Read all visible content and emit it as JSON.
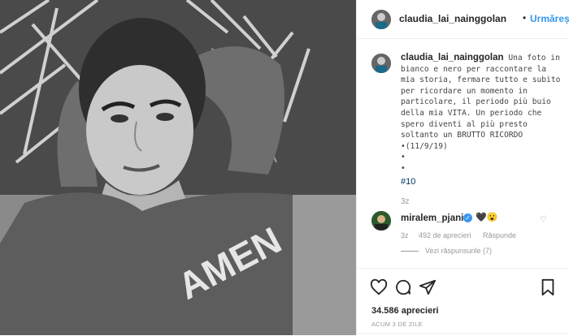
{
  "photo": {
    "alt_shirt_text": "AMEN",
    "colors": {
      "bg": "#7a7a7a",
      "shirt": "#5d5d5d",
      "skin": "#c9c9c9",
      "pillow": "#3a3a3a"
    }
  },
  "header": {
    "username": "claudia_lai_nainggolan",
    "separator": "•",
    "follow_label": "Urmărește"
  },
  "caption": {
    "username": "claudia_lai_nainggolan",
    "text": "Una foto in bianco e nero per raccontare la mia storia, fermare tutto e subito per ricordare un momento in particolare, il periodo più buio della mia VITA. Un periodo che spero diventi al più presto soltanto un BRUTTO RICORDO •(11/9/19)\n•\n•",
    "hashtag": "#10",
    "time": "3z"
  },
  "comment": {
    "username": "miralem_pjanic",
    "verified_icon": "verified-badge-icon",
    "text": "🖤😮",
    "time": "3z",
    "likes": "492 de aprecieri",
    "reply_label": "Răspunde",
    "view_replies": "Vezi răspunsurile (7)"
  },
  "footer": {
    "likes": "34.586 aprecieri",
    "posted_ago": "ACUM 3 DE ZILE"
  },
  "accent": "#3897f0"
}
